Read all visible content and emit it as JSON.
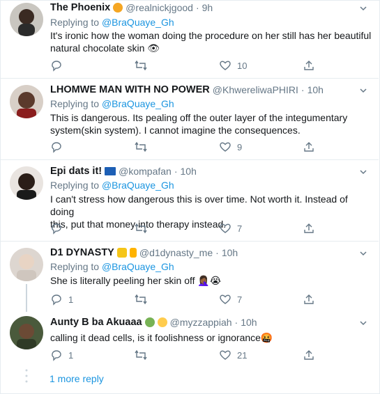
{
  "tweets": [
    {
      "name": "The Phoenix",
      "handle": "@realnickjgood",
      "time": "9h",
      "replying_prefix": "Replying to",
      "replying_to": "@BraQuaye_Gh",
      "text_lines": [
        "It's ironic how the woman doing the procedure on her still has her beautiful",
        "natural chocolate skin 👁"
      ],
      "reply_count": "",
      "like_count": "10",
      "emoji_colors": [
        "#f5a623"
      ]
    },
    {
      "name": "LHOMWE MAN WITH NO POWER",
      "handle": "@KhwereliwaPHIRI",
      "time": "10h",
      "replying_prefix": "Replying to",
      "replying_to": "@BraQuaye_Gh",
      "text_lines": [
        "This is dangerous. Its pealing off the outer layer of the integumentary",
        "system(skin system). I cannot imagine the consequences."
      ],
      "reply_count": "",
      "like_count": "9",
      "emoji_colors": []
    },
    {
      "name": "Epi dats it!",
      "handle": "@kompafan",
      "time": "10h",
      "replying_prefix": "Replying to",
      "replying_to": "@BraQuaye_Gh",
      "text_lines": [
        "I can't stress how dangerous this is over time.  Not worth it.  Instead of doing",
        "this, put that money into therapy instead."
      ],
      "reply_count": "",
      "like_count": "7",
      "emoji_colors": [
        "#1d5fb5"
      ]
    },
    {
      "name": "D1 DYNASTY",
      "handle": "@d1dynasty_me",
      "time": "10h",
      "replying_prefix": "Replying to",
      "replying_to": "@BraQuaye_Gh",
      "text_lines": [
        "She is literally peeling her skin off 🤦🏾‍♀️😭"
      ],
      "reply_count": "1",
      "like_count": "7",
      "emoji_colors": [
        "#f5c518",
        "#ffb300"
      ]
    },
    {
      "name": "Aunty B ba Akuaaa",
      "handle": "@myzzappiah",
      "time": "10h",
      "replying_prefix": "",
      "replying_to": "",
      "text_lines": [
        "calling it dead cells, is it foolishness or ignorance🤬"
      ],
      "reply_count": "1",
      "like_count": "21",
      "emoji_colors": [
        "#77b255",
        "#ffcc4d"
      ]
    }
  ],
  "more_replies": "1 more reply",
  "dot_separator": "·",
  "colors": {
    "link": "#1b95e0",
    "muted": "#657786",
    "text": "#14171a",
    "border": "#e6ecf0"
  },
  "icons": [
    "reply-icon",
    "retweet-icon",
    "like-icon",
    "share-icon",
    "chevron-down-icon"
  ]
}
